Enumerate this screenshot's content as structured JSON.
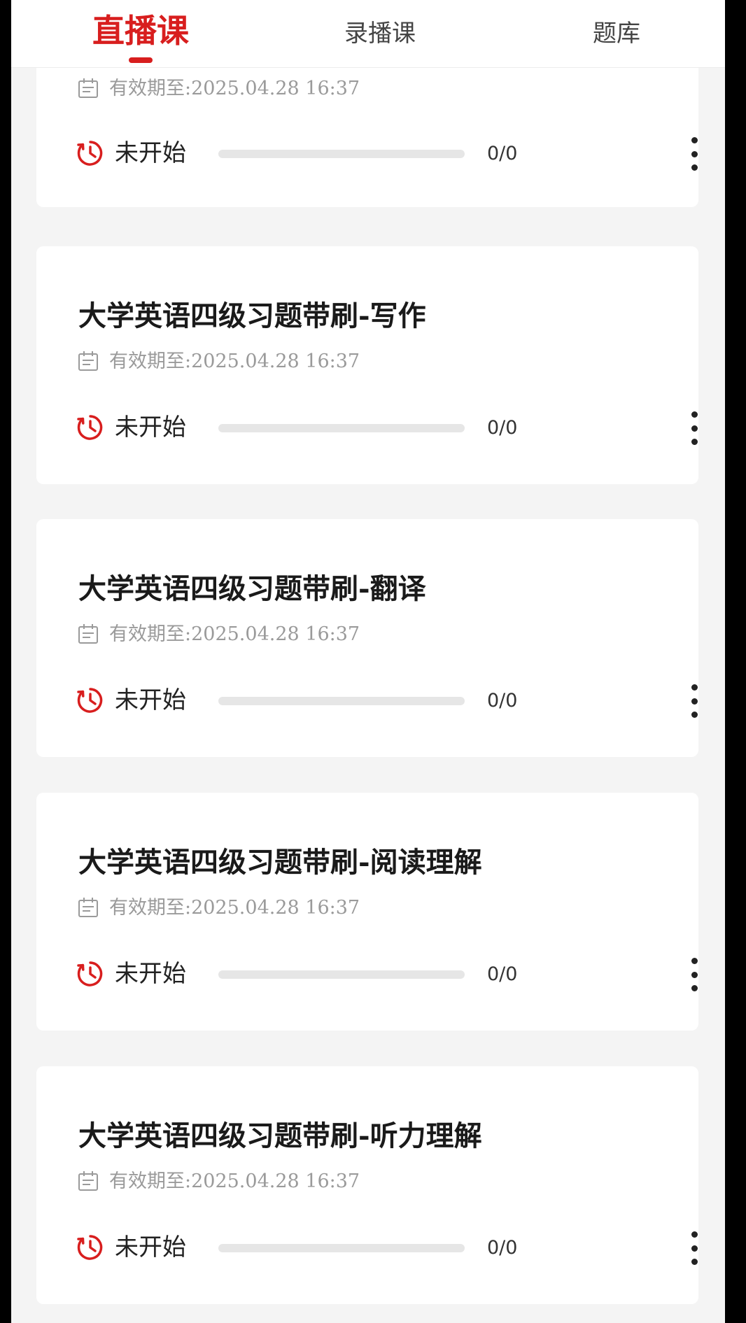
{
  "tabs": [
    {
      "label": "直播课",
      "active": true
    },
    {
      "label": "录播课",
      "active": false
    },
    {
      "label": "题库",
      "active": false
    }
  ],
  "colors": {
    "accent": "#d81e1e",
    "background": "#f4f4f4",
    "card": "#ffffff",
    "muted_text": "#9a9a9a",
    "progress_track": "#e6e6e6"
  },
  "icons": {
    "validity": "calendar-icon",
    "status": "clock-icon",
    "menu": "more-vertical-icon"
  },
  "courses": [
    {
      "title": "",
      "validity": "有效期至:2025.04.28 16:37",
      "status": "未开始",
      "progress": {
        "done": 0,
        "total": 0,
        "fraction": 0
      },
      "progress_label": "0/0"
    },
    {
      "title": "大学英语四级习题带刷-写作",
      "validity": "有效期至:2025.04.28 16:37",
      "status": "未开始",
      "progress": {
        "done": 0,
        "total": 0,
        "fraction": 0
      },
      "progress_label": "0/0"
    },
    {
      "title": "大学英语四级习题带刷-翻译",
      "validity": "有效期至:2025.04.28 16:37",
      "status": "未开始",
      "progress": {
        "done": 0,
        "total": 0,
        "fraction": 0
      },
      "progress_label": "0/0"
    },
    {
      "title": "大学英语四级习题带刷-阅读理解",
      "validity": "有效期至:2025.04.28 16:37",
      "status": "未开始",
      "progress": {
        "done": 0,
        "total": 0,
        "fraction": 0
      },
      "progress_label": "0/0"
    },
    {
      "title": "大学英语四级习题带刷-听力理解",
      "validity": "有效期至:2025.04.28 16:37",
      "status": "未开始",
      "progress": {
        "done": 0,
        "total": 0,
        "fraction": 0
      },
      "progress_label": "0/0"
    }
  ]
}
